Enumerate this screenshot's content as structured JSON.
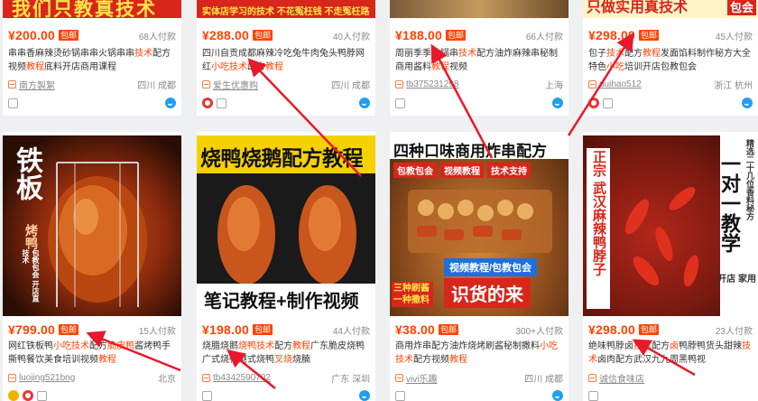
{
  "top_row": [
    {
      "banner": "我们只教真技术",
      "price": "¥200.00",
      "tag": "包邮",
      "paid": "68人付款",
      "title_parts": [
        {
          "t": "串串香麻辣烫砂锅串串火锅串串"
        },
        {
          "t": "技术",
          "hl": true
        },
        {
          "t": "配方视频"
        },
        {
          "t": "教程",
          "hl": true
        },
        {
          "t": "底料开店商用课程"
        }
      ],
      "shop": "南方製絮",
      "loc": "四川 成都"
    },
    {
      "banner": "实体店学习的技术 不花冤枉钱 不走冤枉路",
      "price": "¥288.00",
      "tag": "包邮",
      "paid": "40人付款",
      "title_parts": [
        {
          "t": "四川自贡成都麻辣冷吃兔牛肉兔头鸭脖"
        },
        {
          "t": "网红"
        },
        {
          "t": "小吃技术",
          "hl": true
        },
        {
          "t": "配方"
        },
        {
          "t": "教程",
          "hl": true
        }
      ],
      "shop": "爱生优惠购",
      "loc": "四川 成都"
    },
    {
      "banner": "",
      "price": "¥188.00",
      "tag": "包邮",
      "paid": "66人付款",
      "title_parts": [
        {
          "t": "周丽季季火锅串"
        },
        {
          "t": "技术",
          "hl": true
        },
        {
          "t": "配方油炸麻辣串秘制商用酱料"
        },
        {
          "t": "教程",
          "hl": true
        },
        {
          "t": "视频"
        }
      ],
      "shop": "tb375231298",
      "loc": "上海"
    },
    {
      "banner": "只做实用真技术",
      "banner_side": "包会",
      "price": "¥298.00",
      "tag": "包邮",
      "paid": "45人付款",
      "title_parts": [
        {
          "t": "包子"
        },
        {
          "t": "技术",
          "hl": true
        },
        {
          "t": "配方"
        },
        {
          "t": "教程",
          "hl": true
        },
        {
          "t": "发面馅料制作秘方大全特色"
        },
        {
          "t": "小吃",
          "hl": true
        },
        {
          "t": "培训开店包教包会"
        }
      ],
      "shop": "duihao512",
      "loc": "浙江 杭州"
    }
  ],
  "bottom_row": [
    {
      "img_text_main": "铁板",
      "img_text_sub": "烤鸭",
      "img_text_side": "包教包会 开店直技术",
      "price": "¥799.00",
      "tag": "包邮",
      "paid": "15人付款",
      "title_parts": [
        {
          "t": "网红铁板鸭"
        },
        {
          "t": "小吃技术",
          "hl": true
        },
        {
          "t": "配方"
        },
        {
          "t": "脆皮鸭",
          "hl": true
        },
        {
          "t": "酱烤鸭手撕鸭餐饮美食培训视频"
        },
        {
          "t": "教程",
          "hl": true
        }
      ],
      "shop": "luojing521bng",
      "loc": "北京"
    },
    {
      "img_text_top": "烧鸭烧鹅配方教程",
      "img_text_bottom": "笔记教程+制作视频",
      "price": "¥198.00",
      "tag": "包邮",
      "paid": "44人付款",
      "title_parts": [
        {
          "t": "烧腊烧鹅"
        },
        {
          "t": "烧鸭",
          "hl": true
        },
        {
          "t": "技术",
          "hl": true
        },
        {
          "t": "配方"
        },
        {
          "t": "教程",
          "hl": true
        },
        {
          "t": "广东脆皮烧鸭广式烧鸭港式烧鸭"
        },
        {
          "t": "叉烧",
          "hl": true
        },
        {
          "t": "烧腩"
        }
      ],
      "shop": "tb4342590702",
      "loc": "广东 深圳"
    },
    {
      "img_text_top": "四种口味商用炸串配方",
      "img_badges": [
        "包教包会",
        "视频教程",
        "技术支持"
      ],
      "img_text_mid": "视频教程/包教包会",
      "img_text_left": "三种刷酱 一种撒料",
      "img_text_bottom": "识货的来",
      "price": "¥38.00",
      "tag": "包邮",
      "paid": "300+人付款",
      "title_parts": [
        {
          "t": "商用炸串配方油炸烧烤刷酱秘制撒料"
        },
        {
          "t": "小吃技术",
          "hl": true
        },
        {
          "t": "配方视频"
        },
        {
          "t": "教程",
          "hl": true
        }
      ],
      "shop": "vivi乐趣",
      "loc": "四川 成都"
    },
    {
      "img_text_left": "正宗 武汉麻辣鸭脖子",
      "img_text_right": "精选二十几位香料秘方",
      "img_text_big": "一对一教学",
      "img_text_side": "开店 家用",
      "price": "¥298.00",
      "tag": "包邮",
      "paid": "23人付款",
      "title_parts": [
        {
          "t": "绝味鸭脖卤"
        },
        {
          "t": "技术",
          "hl": true
        },
        {
          "t": "配方"
        },
        {
          "t": "卤",
          "hl": true
        },
        {
          "t": "鸭脖鸭货头甜辣"
        },
        {
          "t": "技术",
          "hl": true
        },
        {
          "t": "卤肉配方武汉九九周黑鸭视"
        }
      ],
      "shop": "诚信食味店",
      "loc": ""
    }
  ],
  "colors": {
    "price": "#ff4400",
    "highlight": "#ff4400",
    "annotation_arrow": "#e8192c"
  }
}
